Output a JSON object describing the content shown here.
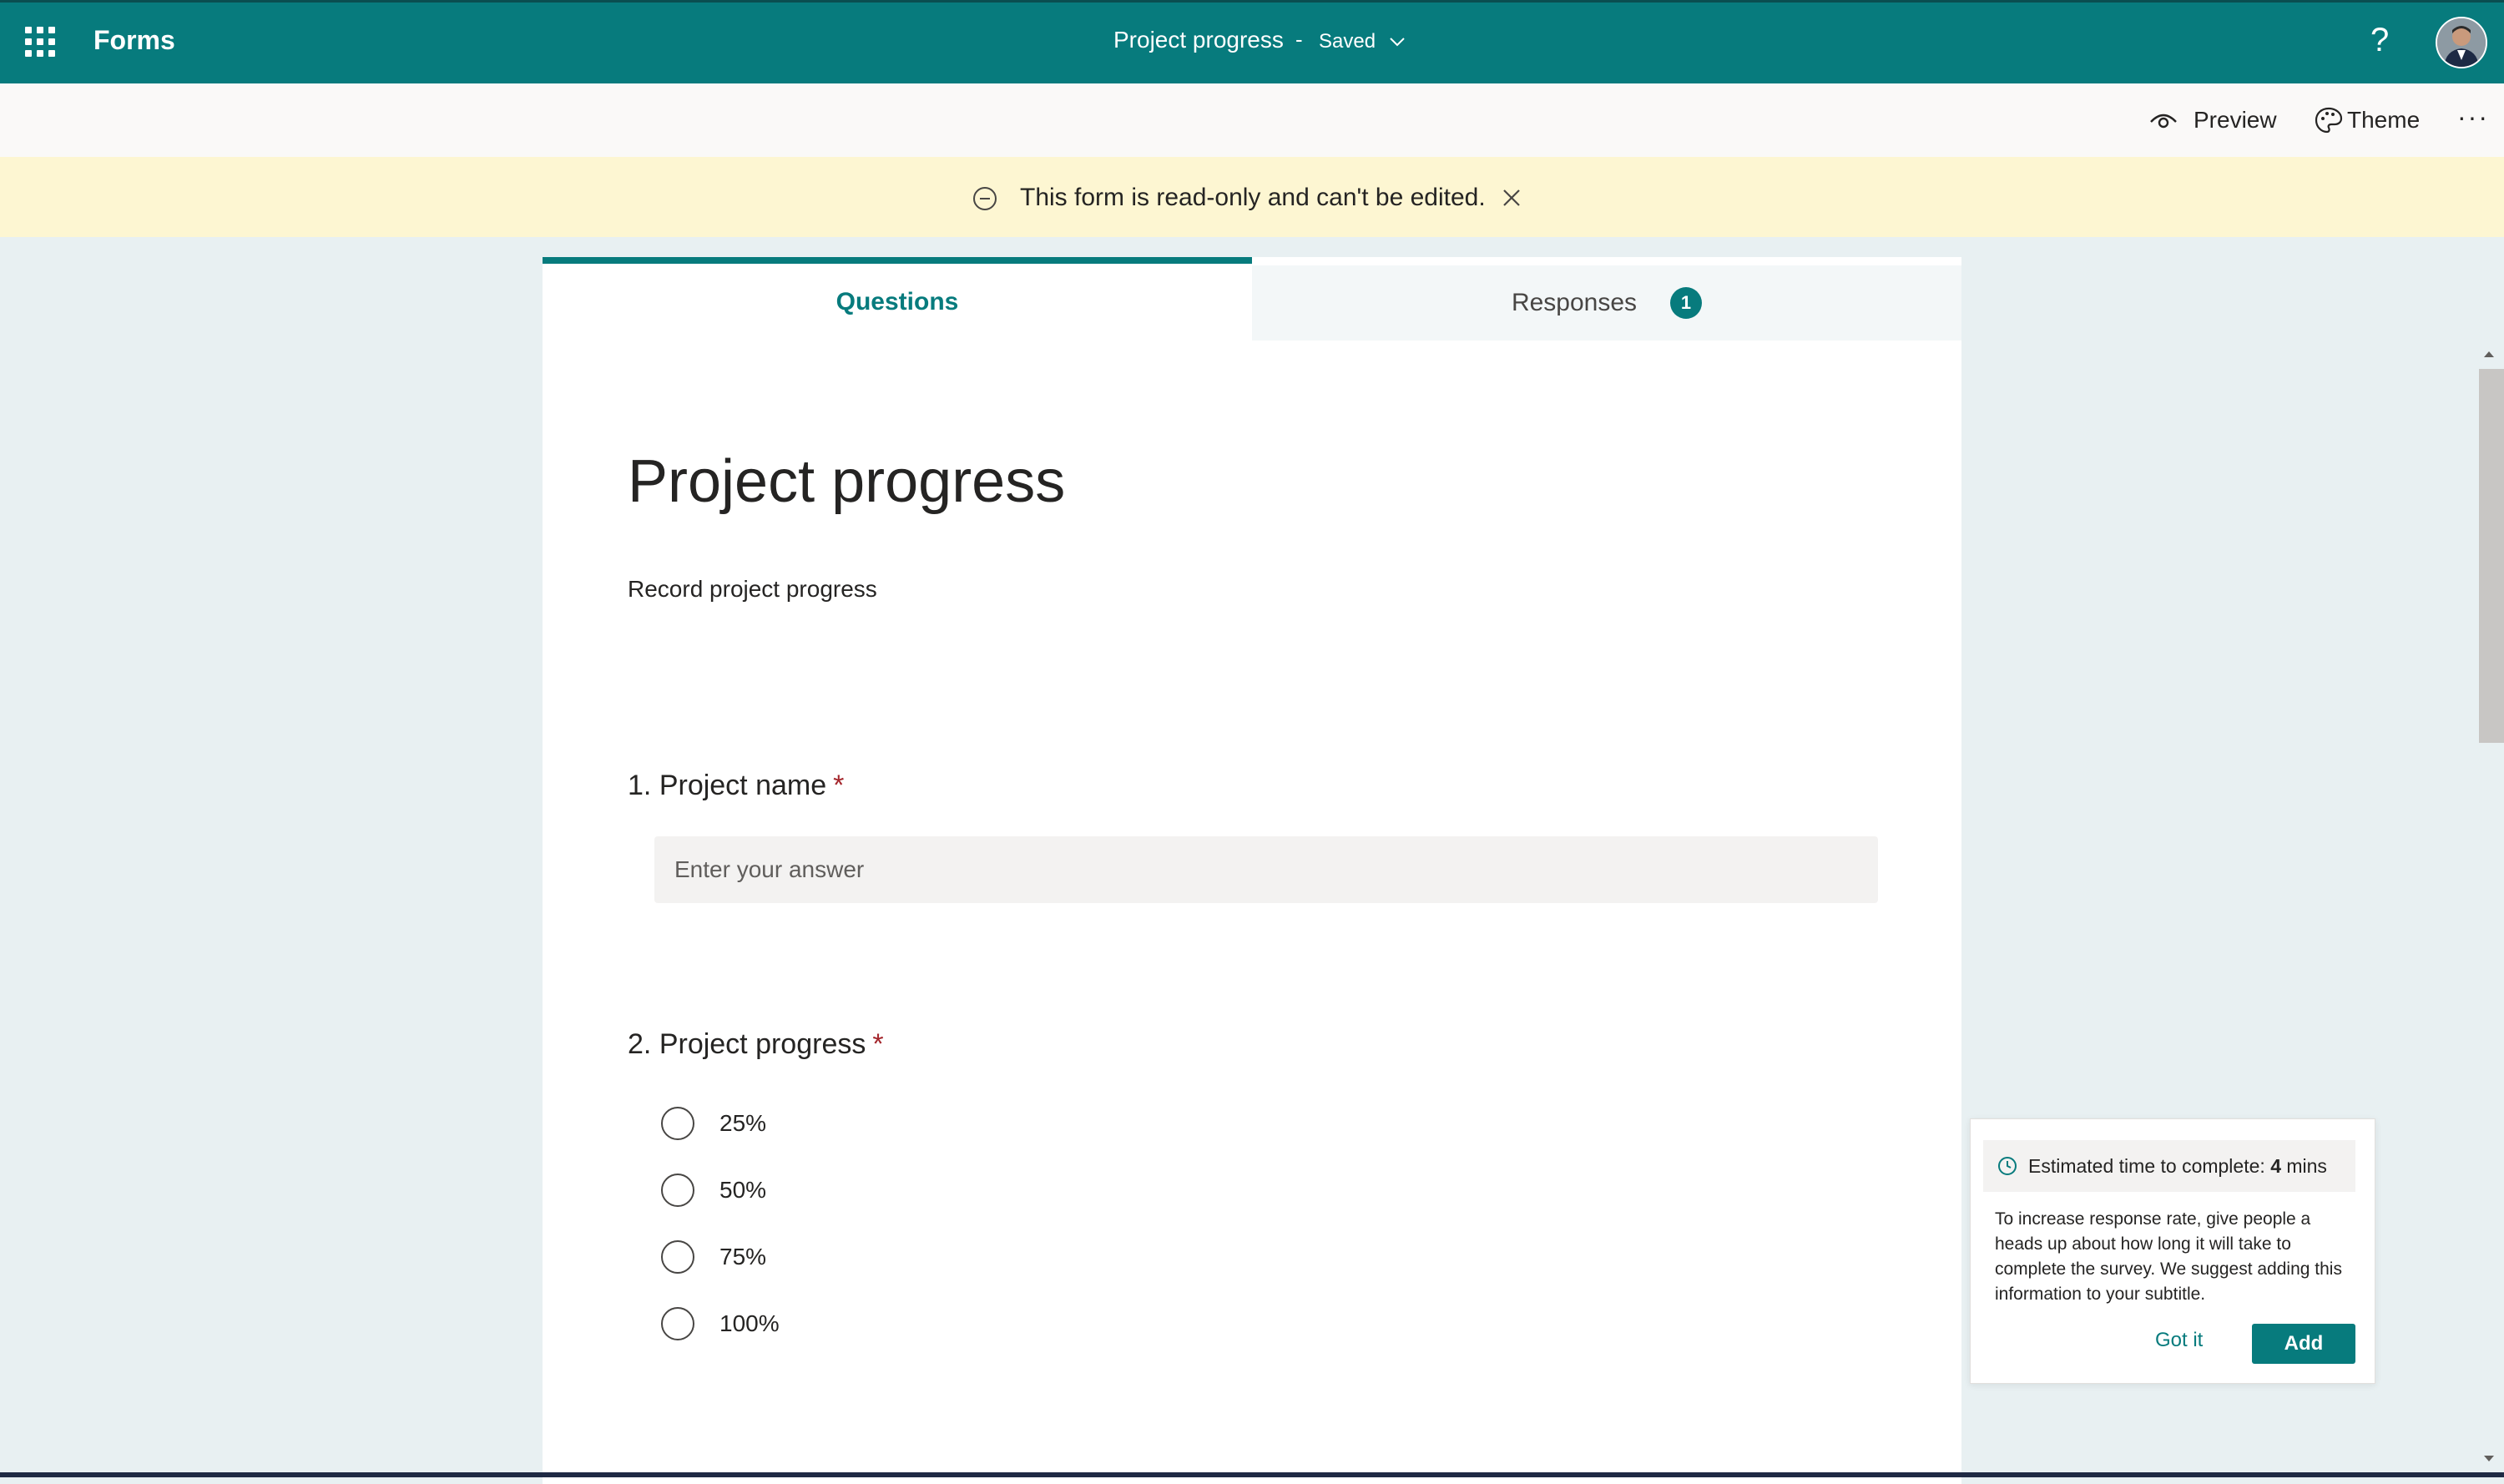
{
  "app": {
    "name": "Forms"
  },
  "header": {
    "form_title": "Project progress",
    "separator": "-",
    "saved_status": "Saved",
    "help_label": "?"
  },
  "toolbar": {
    "preview_label": "Preview",
    "theme_label": "Theme",
    "more_label": "···"
  },
  "banner": {
    "message": "This form is read-only and can't be edited."
  },
  "tabs": {
    "questions_label": "Questions",
    "responses_label": "Responses",
    "responses_count": "1"
  },
  "form": {
    "title": "Project progress",
    "subtitle": "Record project progress",
    "questions": [
      {
        "number": "1.",
        "title": "Project name",
        "required_mark": "*",
        "placeholder": "Enter your answer"
      },
      {
        "number": "2.",
        "title": "Project progress",
        "required_mark": "*",
        "options": [
          "25%",
          "50%",
          "75%",
          "100%"
        ]
      }
    ]
  },
  "tip": {
    "header_prefix": "Estimated time to complete:",
    "header_value": "4",
    "header_unit": "mins",
    "body": "To increase response rate, give people a heads up about how long it will take to complete the survey. We suggest adding this information to your subtitle.",
    "gotit_label": "Got it",
    "add_label": "Add"
  },
  "colors": {
    "brand": "#077b7d",
    "banner": "#fdf6d2",
    "required": "#a4262c"
  },
  "icons": [
    "waffle-icon",
    "chevron-down-icon",
    "help-icon",
    "eye-icon",
    "palette-icon",
    "more-icon",
    "minus-circle-icon",
    "close-icon",
    "clock-icon"
  ]
}
